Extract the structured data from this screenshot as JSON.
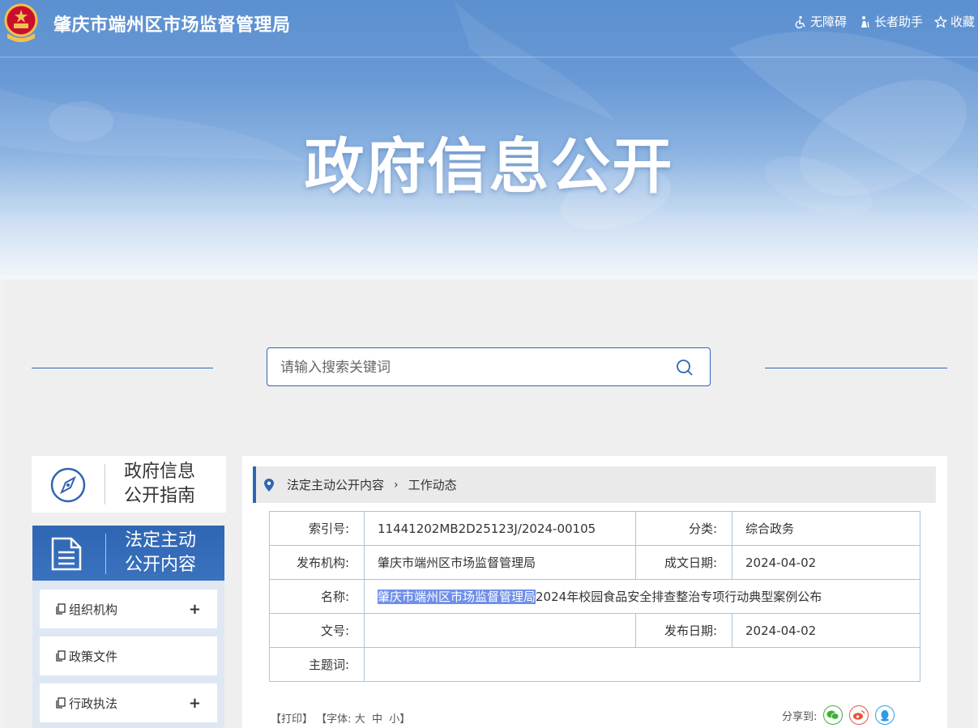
{
  "header": {
    "site_title": "肇庆市端州区市场监督管理局",
    "links": [
      {
        "label": "无障碍",
        "icon": "accessibility-icon"
      },
      {
        "label": "长者助手",
        "icon": "elder-assistant-icon"
      },
      {
        "label": "收藏",
        "icon": "star-icon"
      }
    ],
    "banner_title": "政府信息公开"
  },
  "search": {
    "placeholder": "请输入搜索关键词"
  },
  "sidebar": {
    "guide_line1": "政府信息",
    "guide_line2": "公开指南",
    "active_line1": "法定主动",
    "active_line2": "公开内容",
    "items": [
      {
        "label": "组织机构",
        "expand": "+"
      },
      {
        "label": "政策文件",
        "expand": ""
      },
      {
        "label": "行政执法",
        "expand": "+"
      }
    ]
  },
  "breadcrumb": {
    "item1": "法定主动公开内容",
    "separator": "›",
    "item2": "工作动态"
  },
  "meta": {
    "index_label": "索引号:",
    "index_value": "11441202MB2D25123J/2024-00105",
    "category_label": "分类:",
    "category_value": "综合政务",
    "publisher_label": "发布机构:",
    "publisher_value": "肇庆市端州区市场监督管理局",
    "created_label": "成文日期:",
    "created_value": "2024-04-02",
    "name_label": "名称:",
    "name_highlight": "肇庆市端州区市场监督管理局",
    "name_rest": "2024年校园食品安全排查整治专项行动典型案例公布",
    "docno_label": "文号:",
    "docno_value": "",
    "published_label": "发布日期:",
    "published_value": "2024-04-02",
    "keywords_label": "主题词:",
    "keywords_value": ""
  },
  "tools": {
    "print": "【打印】",
    "font_prefix": "【字体:",
    "large": "大",
    "medium": "中",
    "small": "小",
    "font_suffix": "】"
  },
  "share": {
    "label": "分享到:",
    "targets": [
      "wechat-icon",
      "weibo-icon",
      "qq-icon"
    ]
  },
  "colors": {
    "primary": "#2f66b3",
    "border": "#a9c4de",
    "highlight": "#6f8fe8"
  }
}
